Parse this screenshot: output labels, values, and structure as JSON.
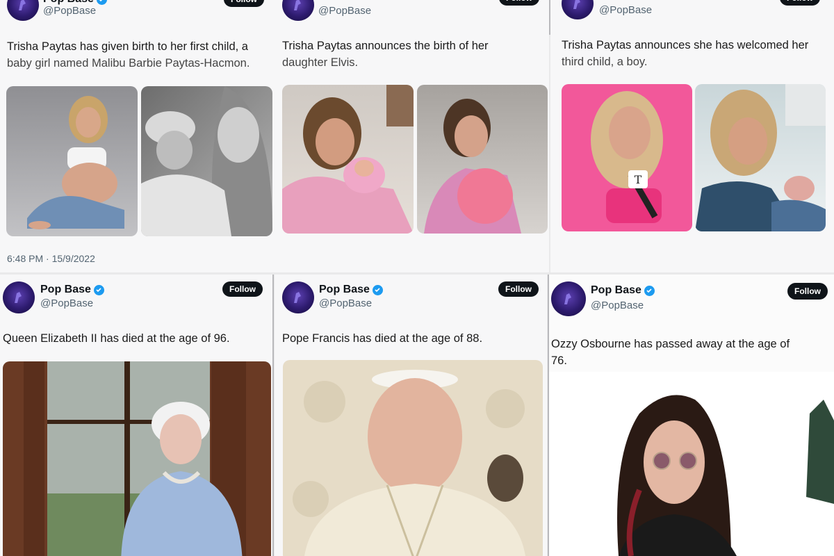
{
  "account": {
    "name": "Pop Base",
    "handle": "@PopBase",
    "follow_label": "Follow",
    "top_name_partial": "Pop Base"
  },
  "top_row": [
    {
      "line1": "Trisha Paytas has given birth to her first child, a",
      "line2": "baby girl named Malibu Barbie Paytas-Hacmon.",
      "timestamp": "6:48 PM · 15/9/2022"
    },
    {
      "line1": "Trisha Paytas announces the birth of her",
      "line2": "daughter Elvis."
    },
    {
      "line1": "Trisha Paytas announces she has welcomed her",
      "line2": "third child, a boy."
    }
  ],
  "bottom_row": [
    {
      "text": "Queen Elizabeth II has died at the age of 96."
    },
    {
      "text": "Pope Francis has died at the age of 88."
    },
    {
      "line1": "Ozzy Osbourne has passed away at the age  of",
      "line2": "76."
    }
  ],
  "mic_flag_letter": "T",
  "colors": {
    "verified": "#1d9bf0",
    "follow_bg": "#0f1419",
    "avatar": "#2d1b6e"
  }
}
